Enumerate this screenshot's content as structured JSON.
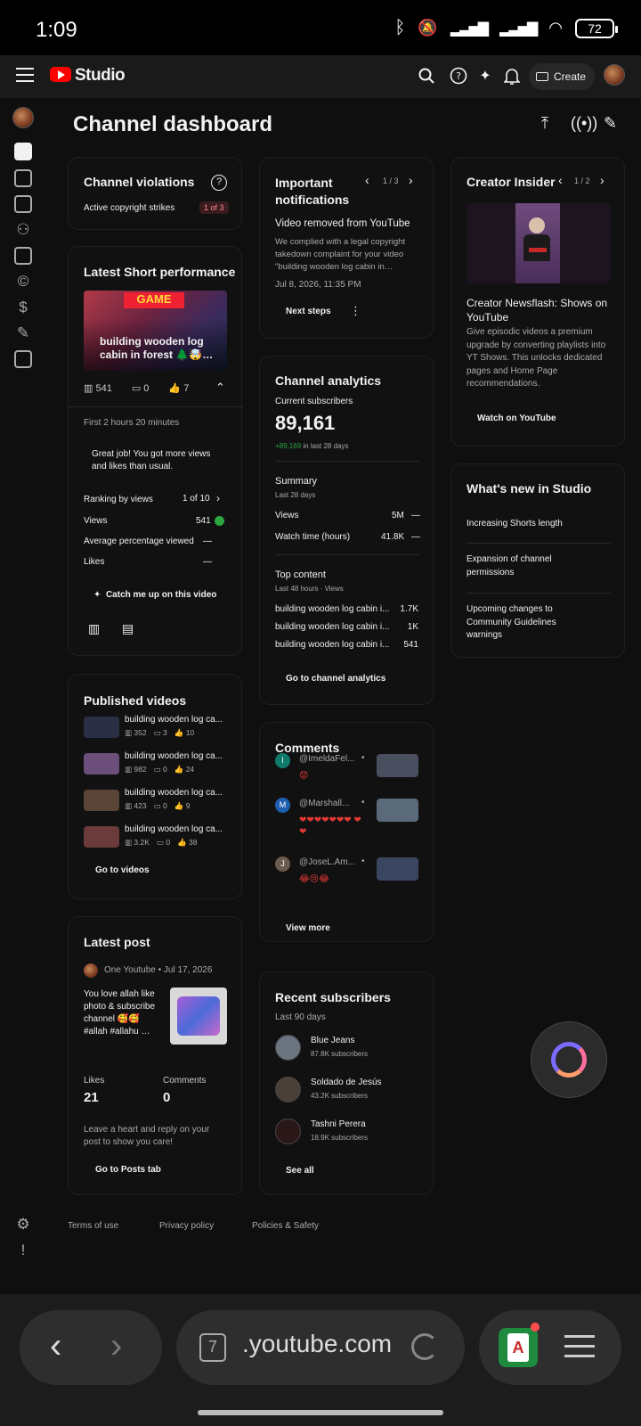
{
  "status": {
    "time": "1:09",
    "battery": "72"
  },
  "topbar": {
    "studio": "Studio",
    "create": "Create"
  },
  "page": {
    "title": "Channel dashboard"
  },
  "violations": {
    "title": "Channel violations",
    "label": "Active copyright strikes",
    "badge": "1 of 3"
  },
  "short_perf": {
    "title": "Latest Short performance",
    "video_title": "building wooden log cabin in forest 🌲🤯…",
    "views": "541",
    "comments": "0",
    "likes": "7",
    "period": "First 2 hours 20 minutes",
    "message": "Great job! You got more views and likes than usual.",
    "ranking_label": "Ranking by views",
    "ranking_value": "1 of 10",
    "views_label": "Views",
    "views_value": "541",
    "avg_label": "Average percentage viewed",
    "avg_value": "—",
    "likes_label": "Likes",
    "likes_value": "—",
    "catch_up": "Catch me up on this video"
  },
  "published": {
    "title": "Published videos",
    "videos": [
      {
        "title": "building wooden log ca...",
        "views": "352",
        "comments": "3",
        "likes": "10"
      },
      {
        "title": "building wooden log ca...",
        "views": "982",
        "comments": "0",
        "likes": "24"
      },
      {
        "title": "building wooden log ca...",
        "views": "423",
        "comments": "0",
        "likes": "9"
      },
      {
        "title": "building wooden log ca...",
        "views": "3.2K",
        "comments": "0",
        "likes": "38"
      }
    ],
    "action": "Go to videos"
  },
  "latest_post": {
    "title": "Latest post",
    "author": "One Youtube",
    "date": "Jul 17, 2026",
    "text": "You love allah like photo & subscribe channel 🥰🥰 #allah #allahu …",
    "likes_label": "Likes",
    "likes_value": "21",
    "comments_label": "Comments",
    "comments_value": "0",
    "prompt": "Leave a heart and reply on your post to show you care!",
    "action": "Go to Posts tab"
  },
  "notifications": {
    "title": "Important notifications",
    "pager": "1 / 3",
    "heading": "Video removed from YouTube",
    "body": "We complied with a legal copyright takedown complaint for your video \"building wooden log cabin in…",
    "date": "Jul 8, 2026, 11:35 PM",
    "action": "Next steps"
  },
  "analytics": {
    "title": "Channel analytics",
    "subs_label": "Current subscribers",
    "subs_value": "89,161",
    "subs_delta": "+89,169",
    "subs_period": " in last 28 days",
    "summary_title": "Summary",
    "summary_period": "Last 28 days",
    "views_label": "Views",
    "views_value": "5M",
    "views_trend": "—",
    "watch_label": "Watch time (hours)",
    "watch_value": "41.8K",
    "watch_trend": "—",
    "top_title": "Top content",
    "top_period": "Last 48 hours · Views",
    "top_items": [
      {
        "title": "building wooden log cabin i...",
        "value": "1.7K"
      },
      {
        "title": "building wooden log cabin i...",
        "value": "1K"
      },
      {
        "title": "building wooden log cabin i...",
        "value": "541"
      }
    ],
    "action": "Go to channel analytics"
  },
  "comments": {
    "title": "Comments",
    "items": [
      {
        "initial": "I",
        "user": "@ImeldaFel...",
        "text": "😟",
        "color": "#0f7a6a"
      },
      {
        "initial": "M",
        "user": "@Marshall...",
        "text": "❤❤❤❤❤❤❤ ❤❤",
        "color": "#1f5fb0"
      },
      {
        "initial": "J",
        "user": "@JoseL.Am...",
        "text": "😂😢😂",
        "color": "#6b5a4e"
      }
    ],
    "action": "View more"
  },
  "recent_subs": {
    "title": "Recent subscribers",
    "period": "Last 90 days",
    "items": [
      {
        "name": "Blue Jeans",
        "subs": "87.8K subscribers"
      },
      {
        "name": "Soldado de Jesús",
        "subs": "43.2K subscribers"
      },
      {
        "name": "Tashni Perera",
        "subs": "18.9K subscribers"
      }
    ],
    "action": "See all"
  },
  "insider": {
    "title": "Creator Insider",
    "pager": "1 / 2",
    "heading": "Creator Newsflash: Shows on YouTube",
    "body": "Give episodic videos a premium upgrade by converting playlists into YT Shows. This unlocks dedicated pages and Home Page recommendations.",
    "action": "Watch on YouTube"
  },
  "whats_new": {
    "title": "What's new in Studio",
    "items": [
      "Increasing Shorts length",
      "Expansion of channel permissions",
      "Upcoming changes to Community Guidelines warnings"
    ]
  },
  "footer": {
    "terms": "Terms of use",
    "privacy": "Privacy policy",
    "policies": "Policies & Safety"
  },
  "browser": {
    "url": ".youtube.com",
    "tabs": "7"
  }
}
